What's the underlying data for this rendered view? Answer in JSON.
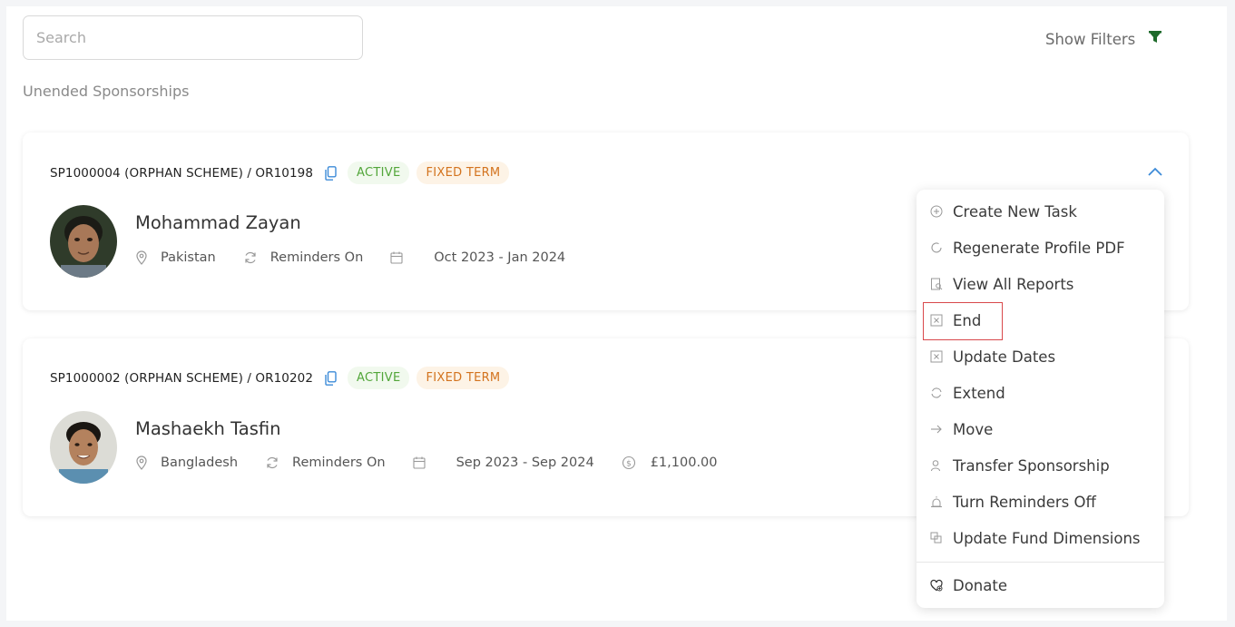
{
  "search": {
    "placeholder": "Search"
  },
  "filters": {
    "label": "Show Filters",
    "icon": "filter-icon",
    "icon_color": "#1f6b2c"
  },
  "section": {
    "title": "Unended Sponsorships"
  },
  "colors": {
    "accent": "#3d8bd8",
    "active_text": "#52a63a",
    "fixed_text": "#d3731e"
  },
  "sponsorships": [
    {
      "reference": "SP1000004 (ORPHAN SCHEME) / OR10198",
      "status": "ACTIVE",
      "term": "FIXED TERM",
      "name": "Mohammad Zayan",
      "country": "Pakistan",
      "reminders": "Reminders On",
      "period": "Oct 2023 - Jan 2024"
    },
    {
      "reference": "SP1000002 (ORPHAN SCHEME) / OR10202",
      "status": "ACTIVE",
      "term": "FIXED TERM",
      "name": "Mashaekh Tasfin",
      "country": "Bangladesh",
      "reminders": "Reminders On",
      "period": "Sep 2023 - Sep 2024",
      "amount": "£1,100.00"
    }
  ],
  "menu": {
    "items": [
      {
        "label": "Create New Task",
        "icon": "plus-circle-icon"
      },
      {
        "label": "Regenerate Profile PDF",
        "icon": "refresh-circle-icon"
      },
      {
        "label": "View All Reports",
        "icon": "report-search-icon"
      },
      {
        "label": "End",
        "icon": "square-x-icon"
      },
      {
        "label": "Update Dates",
        "icon": "square-x-icon"
      },
      {
        "label": "Extend",
        "icon": "refresh-icon"
      },
      {
        "label": "Move",
        "icon": "arrow-right-icon"
      },
      {
        "label": "Transfer Sponsorship",
        "icon": "user-transfer-icon"
      },
      {
        "label": "Turn Reminders Off",
        "icon": "alarm-icon"
      },
      {
        "label": "Update Fund Dimensions",
        "icon": "copy-icon"
      }
    ],
    "donate": {
      "label": "Donate",
      "icon": "heart-plus-icon"
    }
  }
}
